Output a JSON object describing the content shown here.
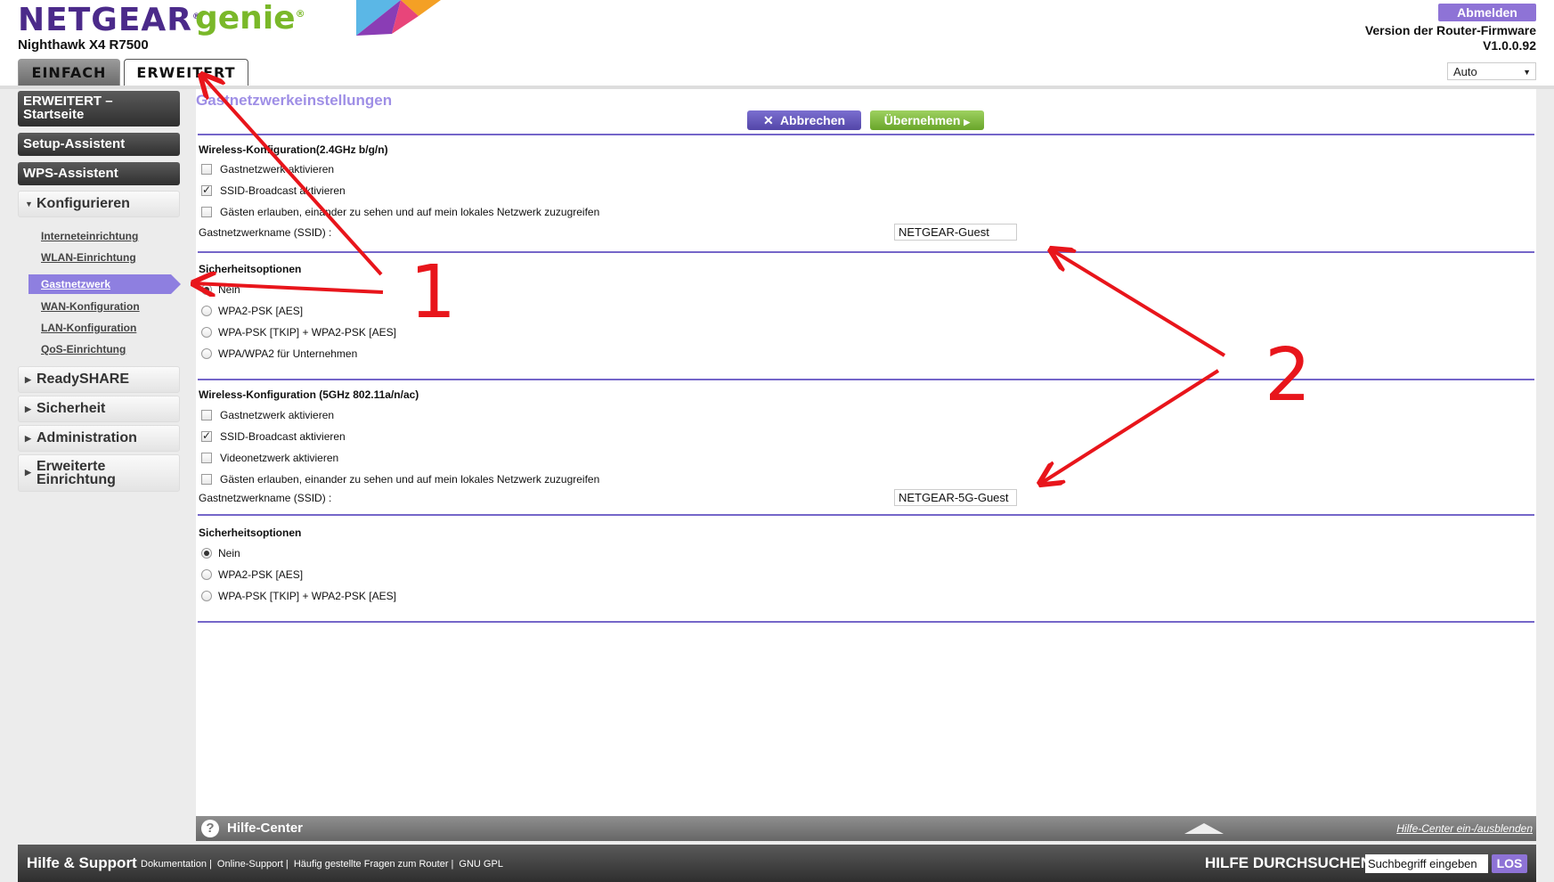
{
  "brand": {
    "name": "NETGEAR",
    "product": "genie",
    "model": "Nighthawk X4 R7500"
  },
  "header": {
    "logout_label": "Abmelden",
    "firmware_label": "Version der Router-Firmware",
    "firmware_version": "V1.0.0.92",
    "language_selected": "Auto"
  },
  "tabs": [
    {
      "label": "EINFACH"
    },
    {
      "label": "ERWEITERT"
    }
  ],
  "sidebar": {
    "home_label": "ERWEITERT –\nStartseite",
    "setup_label": "Setup-Assistent",
    "wps_label": "WPS-Assistent",
    "configure_label": "Konfigurieren",
    "sub_items": [
      {
        "label": "Interneteinrichtung"
      },
      {
        "label": "WLAN-Einrichtung"
      },
      {
        "label": "Gastnetzwerk"
      },
      {
        "label": "WAN-Konfiguration"
      },
      {
        "label": "LAN-Konfiguration"
      },
      {
        "label": "QoS-Einrichtung"
      }
    ],
    "readyshare_label": "ReadySHARE",
    "security_label": "Sicherheit",
    "admin_label": "Administration",
    "advanced_setup_label": "Erweiterte Einrichtung"
  },
  "main": {
    "title": "Gastnetzwerkeinstellungen",
    "cancel_label": "Abbrechen",
    "apply_label": "Übernehmen",
    "band24": {
      "title": "Wireless-Konfiguration(2.4GHz b/g/n)",
      "options": [
        {
          "label": "Gastnetzwerk aktivieren",
          "checked": false
        },
        {
          "label": "SSID-Broadcast aktivieren",
          "checked": true
        },
        {
          "label": "Gästen erlauben, einander zu sehen und auf mein lokales Netzwerk zuzugreifen",
          "checked": false
        }
      ],
      "ssid_label": "Gastnetzwerkname (SSID) :",
      "ssid_value": "NETGEAR-Guest",
      "security_title": "Sicherheitsoptionen",
      "security_options": [
        {
          "label": "Nein",
          "selected": true
        },
        {
          "label": "WPA2-PSK [AES]",
          "selected": false
        },
        {
          "label": "WPA-PSK [TKIP] + WPA2-PSK [AES]",
          "selected": false
        },
        {
          "label": "WPA/WPA2 für Unternehmen",
          "selected": false
        }
      ]
    },
    "band5": {
      "title": "Wireless-Konfiguration (5GHz 802.11a/n/ac)",
      "options": [
        {
          "label": "Gastnetzwerk aktivieren",
          "checked": false
        },
        {
          "label": "SSID-Broadcast aktivieren",
          "checked": true
        },
        {
          "label": "Videonetzwerk aktivieren",
          "checked": false
        },
        {
          "label": "Gästen erlauben, einander zu sehen und auf mein lokales Netzwerk zuzugreifen",
          "checked": false
        }
      ],
      "ssid_label": "Gastnetzwerkname (SSID) :",
      "ssid_value": "NETGEAR-5G-Guest",
      "security_title": "Sicherheitsoptionen",
      "security_options": [
        {
          "label": "Nein",
          "selected": true
        },
        {
          "label": "WPA2-PSK [AES]",
          "selected": false
        },
        {
          "label": "WPA-PSK [TKIP] + WPA2-PSK [AES]",
          "selected": false
        }
      ]
    }
  },
  "help_center": {
    "title": "Hilfe-Center",
    "toggle_label": "Hilfe-Center ein-/ausblenden"
  },
  "footer": {
    "title": "Hilfe & Support",
    "links": [
      "Dokumentation",
      "Online-Support",
      "Häufig gestellte Fragen zum Router",
      "GNU GPL"
    ],
    "search_label": "HILFE DURCHSUCHEN",
    "search_placeholder": "Suchbegriff eingeben",
    "search_button": "LOS"
  },
  "annotations": {
    "marker_1": "1",
    "marker_2": "2",
    "color": "#e8151b"
  },
  "colors": {
    "accent": "#8e73d6",
    "apply_green": "#7ab829",
    "brand_purple": "#4b2a8a"
  }
}
